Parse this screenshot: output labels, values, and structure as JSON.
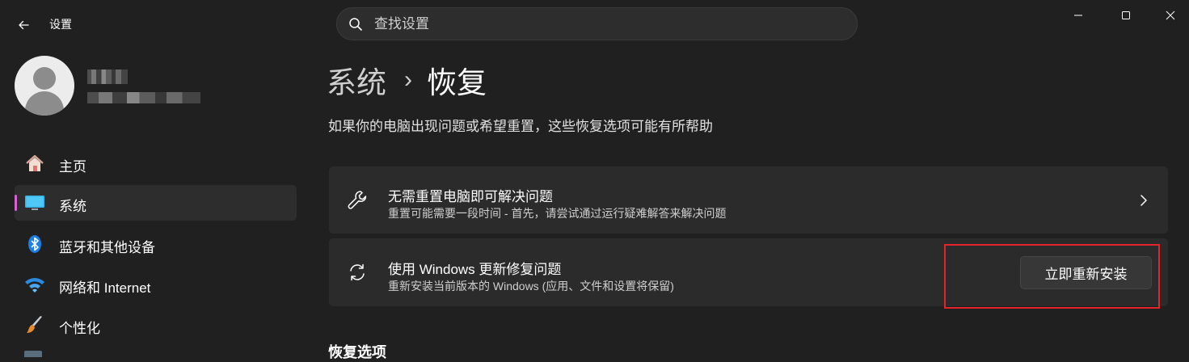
{
  "window": {
    "title": "设置",
    "minimize_icon": "minimize-icon",
    "maximize_icon": "maximize-icon",
    "close_icon": "close-icon"
  },
  "search": {
    "placeholder": "查找设置"
  },
  "sidebar": {
    "items": [
      {
        "label": "主页",
        "icon": "home-icon",
        "active": false
      },
      {
        "label": "系统",
        "icon": "monitor-icon",
        "active": true
      },
      {
        "label": "蓝牙和其他设备",
        "icon": "bluetooth-icon",
        "active": false
      },
      {
        "label": "网络和 Internet",
        "icon": "wifi-icon",
        "active": false
      },
      {
        "label": "个性化",
        "icon": "brush-icon",
        "active": false
      }
    ]
  },
  "main": {
    "breadcrumb_parent": "系统",
    "breadcrumb_separator": "›",
    "breadcrumb_current": "恢复",
    "description": "如果你的电脑出现问题或希望重置，这些恢复选项可能有所帮助",
    "cards": [
      {
        "title": "无需重置电脑即可解决问题",
        "subtitle": "重置可能需要一段时间 - 首先，请尝试通过运行疑难解答来解决问题",
        "icon": "wrench-icon"
      },
      {
        "title": "使用 Windows 更新修复问题",
        "subtitle": "重新安装当前版本的 Windows (应用、文件和设置将保留)",
        "icon": "sync-icon",
        "button_label": "立即重新安装"
      }
    ],
    "section_title": "恢复选项"
  },
  "colors": {
    "background": "#202020",
    "card": "#2b2b2b",
    "accent_indicator": "#d762d4",
    "highlight_border": "#e5232b"
  }
}
